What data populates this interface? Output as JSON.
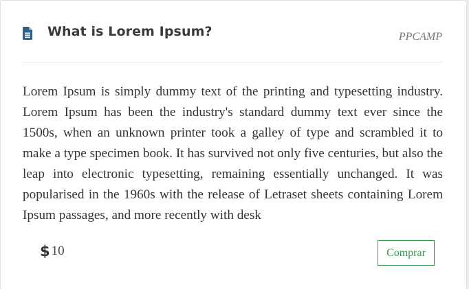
{
  "card": {
    "title": "What is Lorem Ipsum?",
    "title_icon": "document-icon",
    "author": "PPCAMP",
    "description": "Lorem Ipsum is simply dummy text of the printing and typesetting industry. Lorem Ipsum has been the industry's standard dummy text ever since the 1500s, when an unknown printer took a galley of type and scrambled it to make a type specimen book. It has survived not only five centuries, but also the leap into electronic typesetting, remaining essentially unchanged. It was popularised in the 1960s with the release of Letraset sheets containing Lorem Ipsum passages, and more recently with desk",
    "price": {
      "currency_symbol": "$",
      "currency_icon": "dollar-icon",
      "value": "10"
    },
    "buy_button_label": "Comprar"
  },
  "colors": {
    "icon": "#2c5f8a",
    "title": "#3a3a3a",
    "author": "#777777",
    "body_text": "#333333",
    "button_accent": "#2e9a49",
    "divider": "#e8e8e8"
  }
}
